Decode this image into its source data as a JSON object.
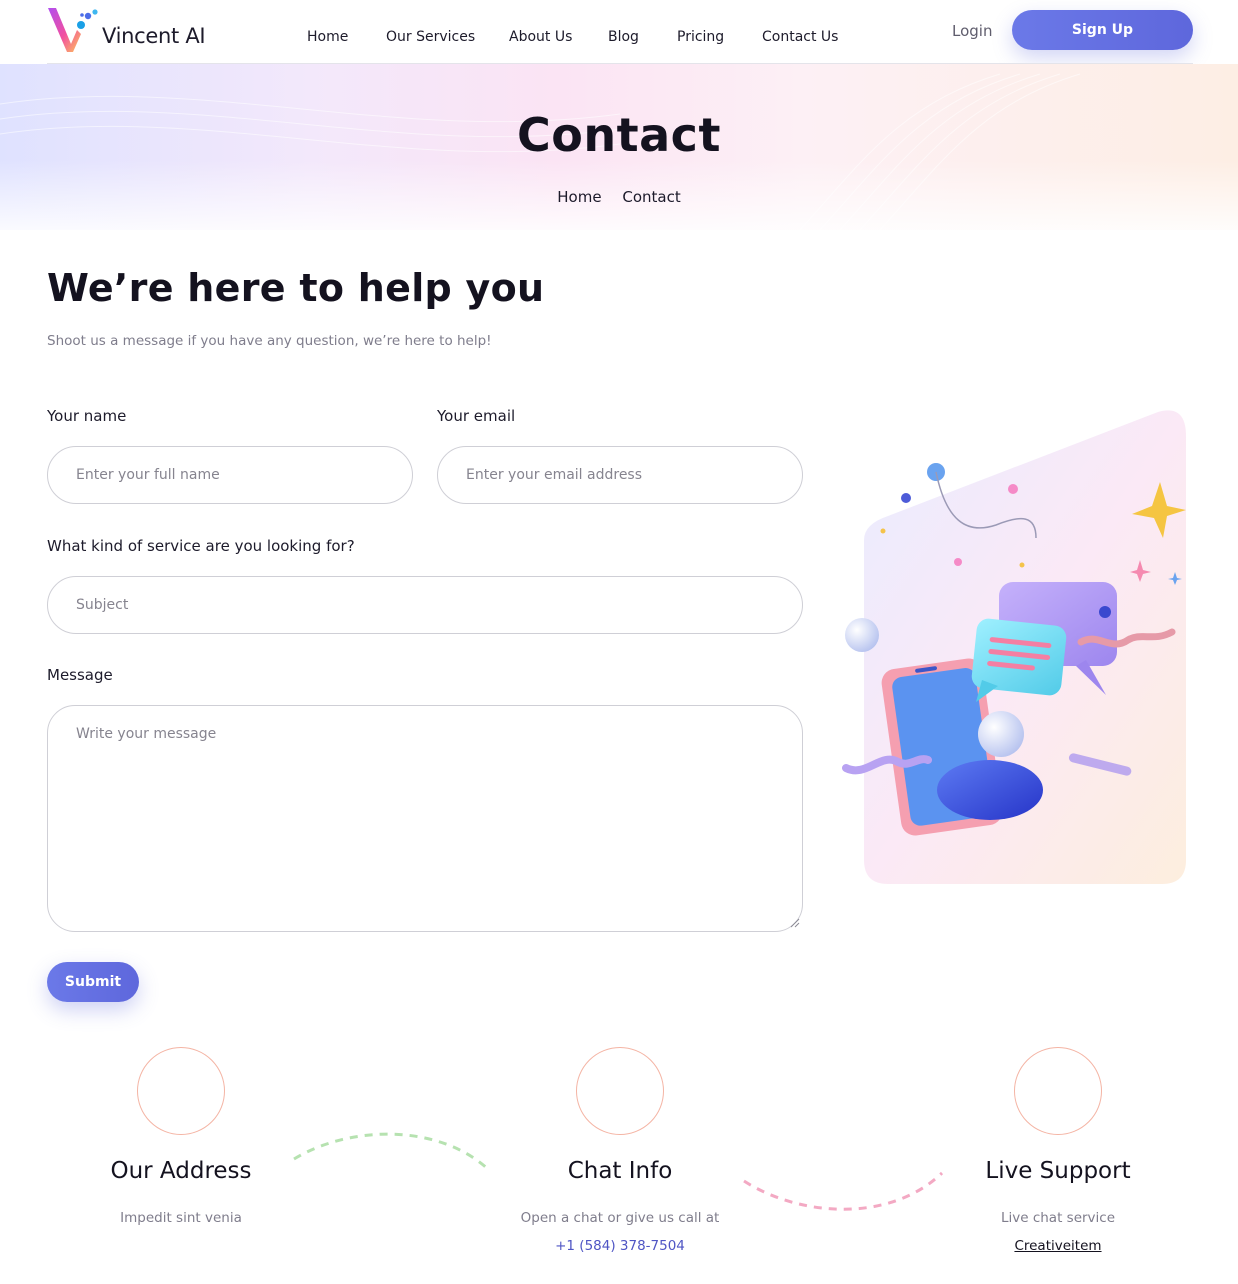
{
  "brand": {
    "name": "Vincent AI"
  },
  "nav": {
    "items": [
      "Home",
      "Our Services",
      "About Us",
      "Blog",
      "Pricing",
      "Contact Us"
    ],
    "login": "Login",
    "signup": "Sign Up"
  },
  "hero": {
    "title": "Contact",
    "breadcrumb": [
      "Home",
      "Contact"
    ]
  },
  "contact": {
    "headline": "We’re here to help you",
    "subline": "Shoot us a message if you have any question, we’re here to help!",
    "name_label": "Your name",
    "name_placeholder": "Enter your full name",
    "email_label": "Your email",
    "email_placeholder": "Enter your email address",
    "service_label": "What kind of service are you looking for?",
    "service_placeholder": "Subject",
    "message_label": "Message",
    "message_placeholder": "Write your message",
    "submit": "Submit"
  },
  "info": [
    {
      "title": "Our Address",
      "text": "Impedit sint venia",
      "link": ""
    },
    {
      "title": "Chat Info",
      "text": "Open a chat or give us call at",
      "link": "+1 (584) 378-7504"
    },
    {
      "title": "Live Support",
      "text": "Live chat service",
      "link": "Creativeitem"
    }
  ],
  "colors": {
    "accent": "#5e67dc",
    "circle_border": "#f4b4a4",
    "link_phone": "#4f55c4",
    "dash_green": "#b6e2b0",
    "dash_pink": "#f3a9c3"
  }
}
